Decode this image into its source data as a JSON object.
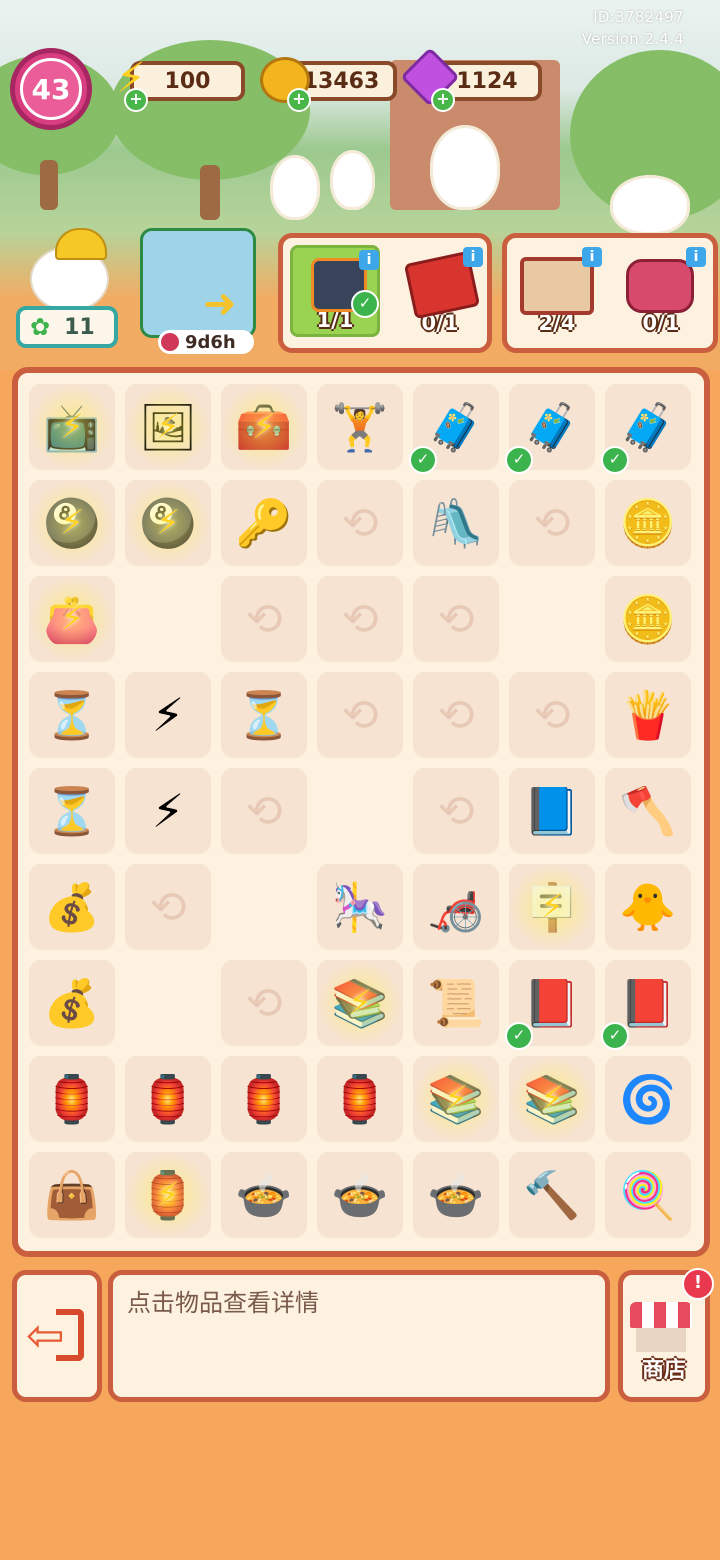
{
  "top": {
    "id_text": "ID:3782497",
    "version_text": "Version:2.4.4",
    "level": "43",
    "energy": "100",
    "coins": "13463",
    "gems": "1124"
  },
  "status": {
    "friend_count": "11",
    "event_timer": "9d6h"
  },
  "orders": [
    {
      "count": "1/1",
      "icon": "toolbox-icon",
      "done": true
    },
    {
      "count": "0/1",
      "icon": "book-icon",
      "done": false
    },
    {
      "count": "2/4",
      "icon": "recipe-book-icon",
      "done": false
    },
    {
      "count": "0/1",
      "icon": "bag-icon",
      "done": false
    }
  ],
  "board": [
    [
      "tv-icon",
      "photo-icon",
      "treasure-chest-icon",
      "exercise-bench-icon",
      "toolbox-icon",
      "toolbox-icon",
      "toolbox-icon"
    ],
    [
      "coin-ball-icon",
      "coin-ball-icon",
      "key-icon",
      "locked",
      "slide-icon",
      "locked",
      "coin-icon"
    ],
    [
      "wallet-icon",
      "empty",
      "locked",
      "locked",
      "locked",
      "empty",
      "coins-icon"
    ],
    [
      "hourglass-gold-icon",
      "energy-orb-icon",
      "hourglass-green-icon",
      "locked",
      "locked",
      "locked",
      "snack-icon"
    ],
    [
      "hourglass-blue-icon",
      "energy-blue-icon",
      "locked",
      "empty",
      "locked",
      "book-icon",
      "axe-stand-icon"
    ],
    [
      "coins-stack-icon",
      "locked",
      "empty",
      "swing-icon",
      "walker-icon",
      "poster-icon",
      "duck-ribbon-icon"
    ],
    [
      "coin-pile-icon",
      "empty",
      "locked",
      "books-icon",
      "scroll-icon",
      "recipe-book-icon",
      "recipe-book-icon"
    ],
    [
      "stand-icon",
      "stand-icon",
      "stand-icon",
      "stand-icon",
      "books-icon",
      "books-icon",
      "spin-coin-icon"
    ],
    [
      "bag-icon",
      "lantern-icon",
      "duck-bowl-icon",
      "duck-bowl-icon",
      "duck-bowl-icon",
      "mace-icon",
      "lollipop-icon"
    ]
  ],
  "bottom": {
    "hint": "点击物品查看详情",
    "shop_label": "商店",
    "exit_icon": "exit-icon"
  }
}
